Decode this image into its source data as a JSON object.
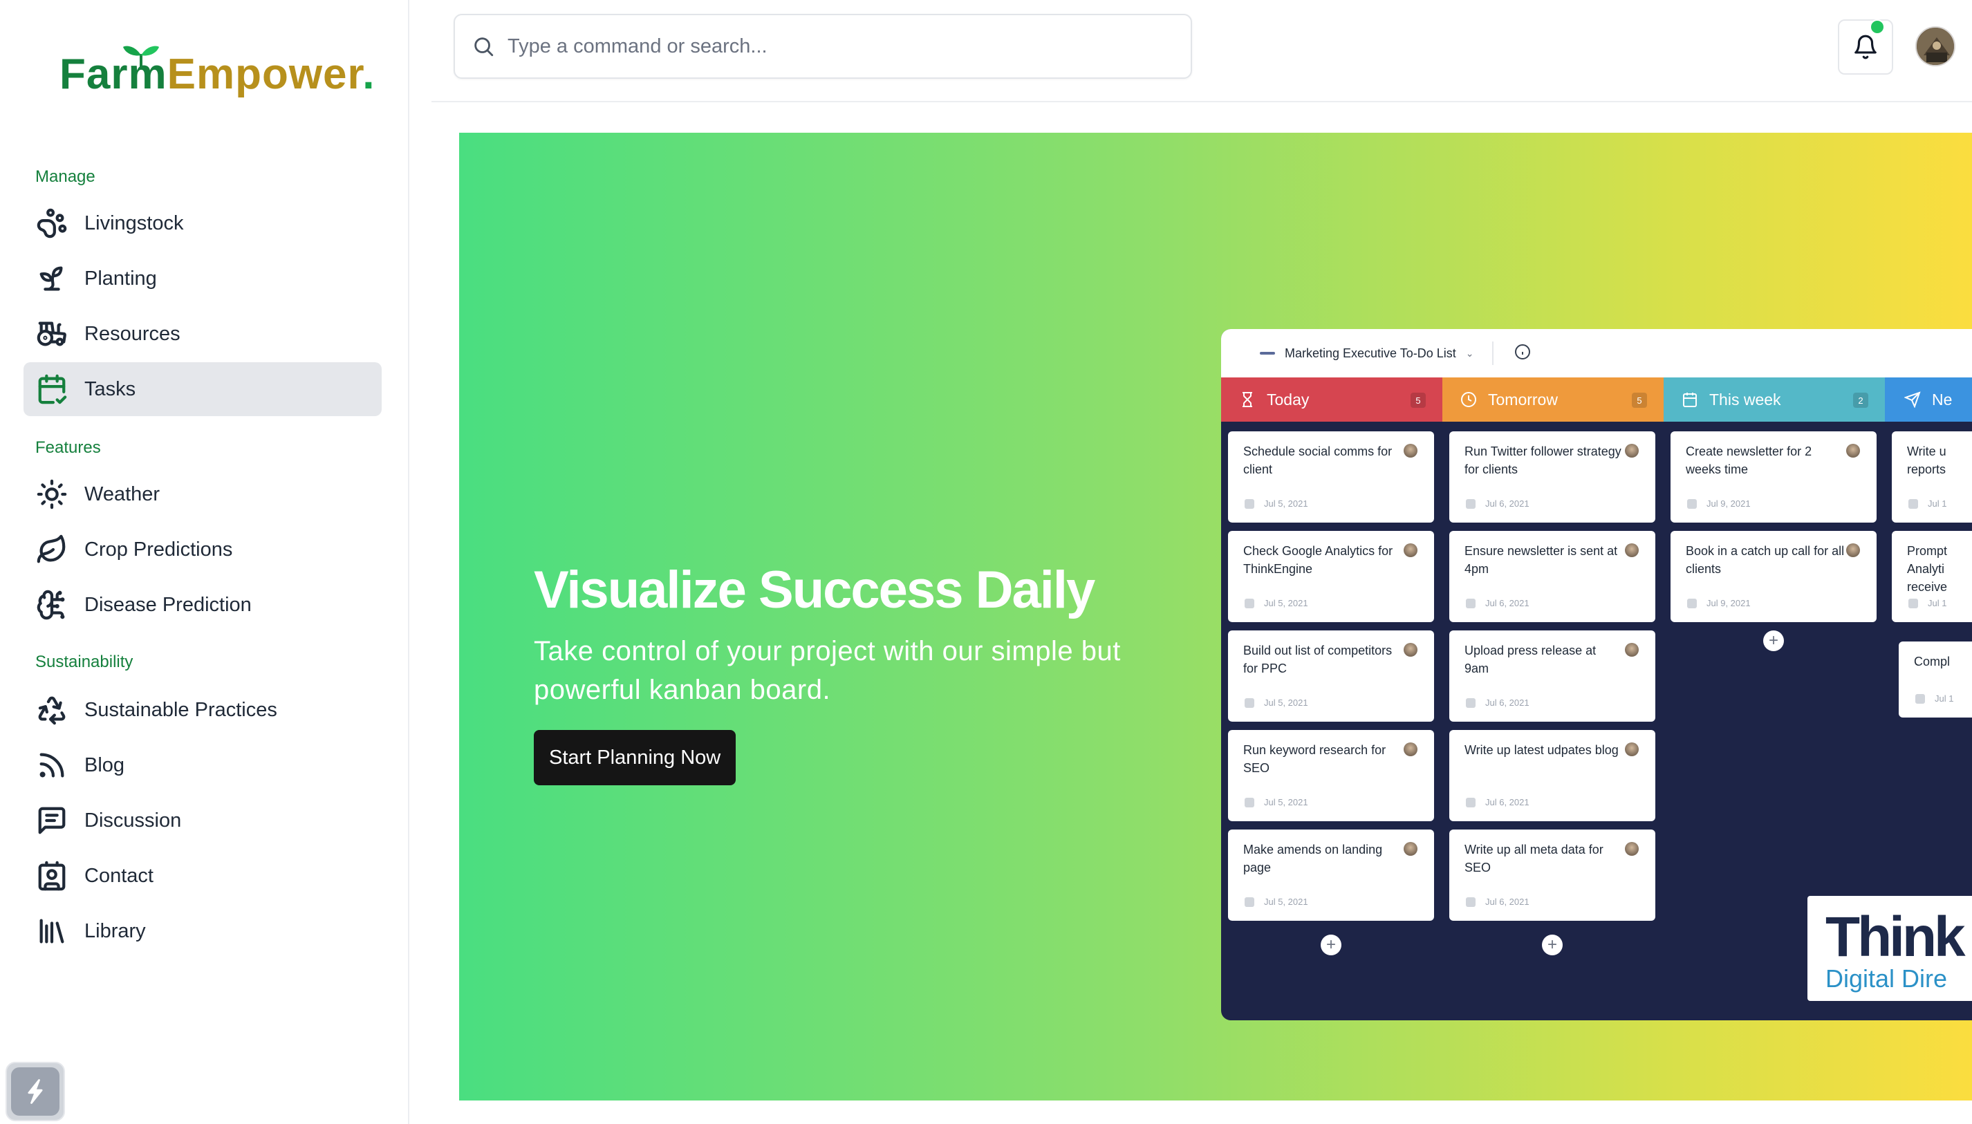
{
  "brand": {
    "part1": "Farm",
    "part2": "Empower",
    "dot": "."
  },
  "search": {
    "placeholder": "Type a command or search..."
  },
  "sidebar": {
    "sections": [
      {
        "title": "Manage",
        "items": [
          {
            "label": "Livingstock",
            "icon": "paw-icon"
          },
          {
            "label": "Planting",
            "icon": "sprout-icon"
          },
          {
            "label": "Resources",
            "icon": "tractor-icon"
          },
          {
            "label": "Tasks",
            "icon": "calendar-check-icon",
            "active": true
          }
        ]
      },
      {
        "title": "Features",
        "items": [
          {
            "label": "Weather",
            "icon": "sun-icon"
          },
          {
            "label": "Crop Predictions",
            "icon": "leaf-icon"
          },
          {
            "label": "Disease Prediction",
            "icon": "brain-icon"
          }
        ]
      },
      {
        "title": "Sustainability",
        "items": [
          {
            "label": "Sustainable Practices",
            "icon": "recycle-icon"
          },
          {
            "label": "Blog",
            "icon": "rss-icon"
          },
          {
            "label": "Discussion",
            "icon": "message-square-icon"
          },
          {
            "label": "Contact",
            "icon": "contact-icon"
          },
          {
            "label": "Library",
            "icon": "library-icon"
          }
        ]
      }
    ]
  },
  "hero": {
    "title": "Visualize Success Daily",
    "subtitle": "Take control of your project with our simple but powerful kanban board.",
    "cta": "Start Planning Now"
  },
  "board": {
    "title": "Marketing Executive To-Do List",
    "columns": [
      {
        "name": "Today",
        "count": "5",
        "color": "#d64550",
        "icon": "hourglass-icon",
        "cards": [
          {
            "text": "Schedule social comms for client",
            "date": "Jul 5, 2021"
          },
          {
            "text": "Check Google Analytics for ThinkEngine",
            "date": "Jul 5, 2021"
          },
          {
            "text": "Build out list of competitors for PPC",
            "date": "Jul 5, 2021"
          },
          {
            "text": "Run keyword research for SEO",
            "date": "Jul 5, 2021"
          },
          {
            "text": "Make amends on landing page",
            "date": "Jul 5, 2021"
          }
        ]
      },
      {
        "name": "Tomorrow",
        "count": "5",
        "color": "#ef9a3c",
        "icon": "clock-icon",
        "cards": [
          {
            "text": "Run Twitter follower strategy for clients",
            "date": "Jul 6, 2021"
          },
          {
            "text": "Ensure newsletter is sent at 4pm",
            "date": "Jul 6, 2021"
          },
          {
            "text": "Upload press release at 9am",
            "date": "Jul 6, 2021"
          },
          {
            "text": "Write up latest udpates blog",
            "date": "Jul 6, 2021"
          },
          {
            "text": "Write up all meta data for SEO",
            "date": "Jul 6, 2021"
          }
        ]
      },
      {
        "name": "This week",
        "count": "2",
        "color": "#54b8c8",
        "icon": "calendar-icon",
        "cards": [
          {
            "text": "Create newsletter for 2 weeks time",
            "date": "Jul 9, 2021"
          },
          {
            "text": "Book in a catch up call for all clients",
            "date": "Jul 9, 2021"
          }
        ]
      },
      {
        "name": "Ne",
        "count": "",
        "color": "#3b93e0",
        "icon": "send-icon",
        "cards": [
          {
            "text": "Write u reports",
            "date": "Jul 1"
          },
          {
            "text": "Prompt Analyti receive",
            "date": "Jul 1"
          },
          {
            "text": "Compl",
            "date": "Jul 1"
          }
        ]
      }
    ],
    "watermark": {
      "line1": "Think",
      "line2": "Digital Dire"
    }
  }
}
